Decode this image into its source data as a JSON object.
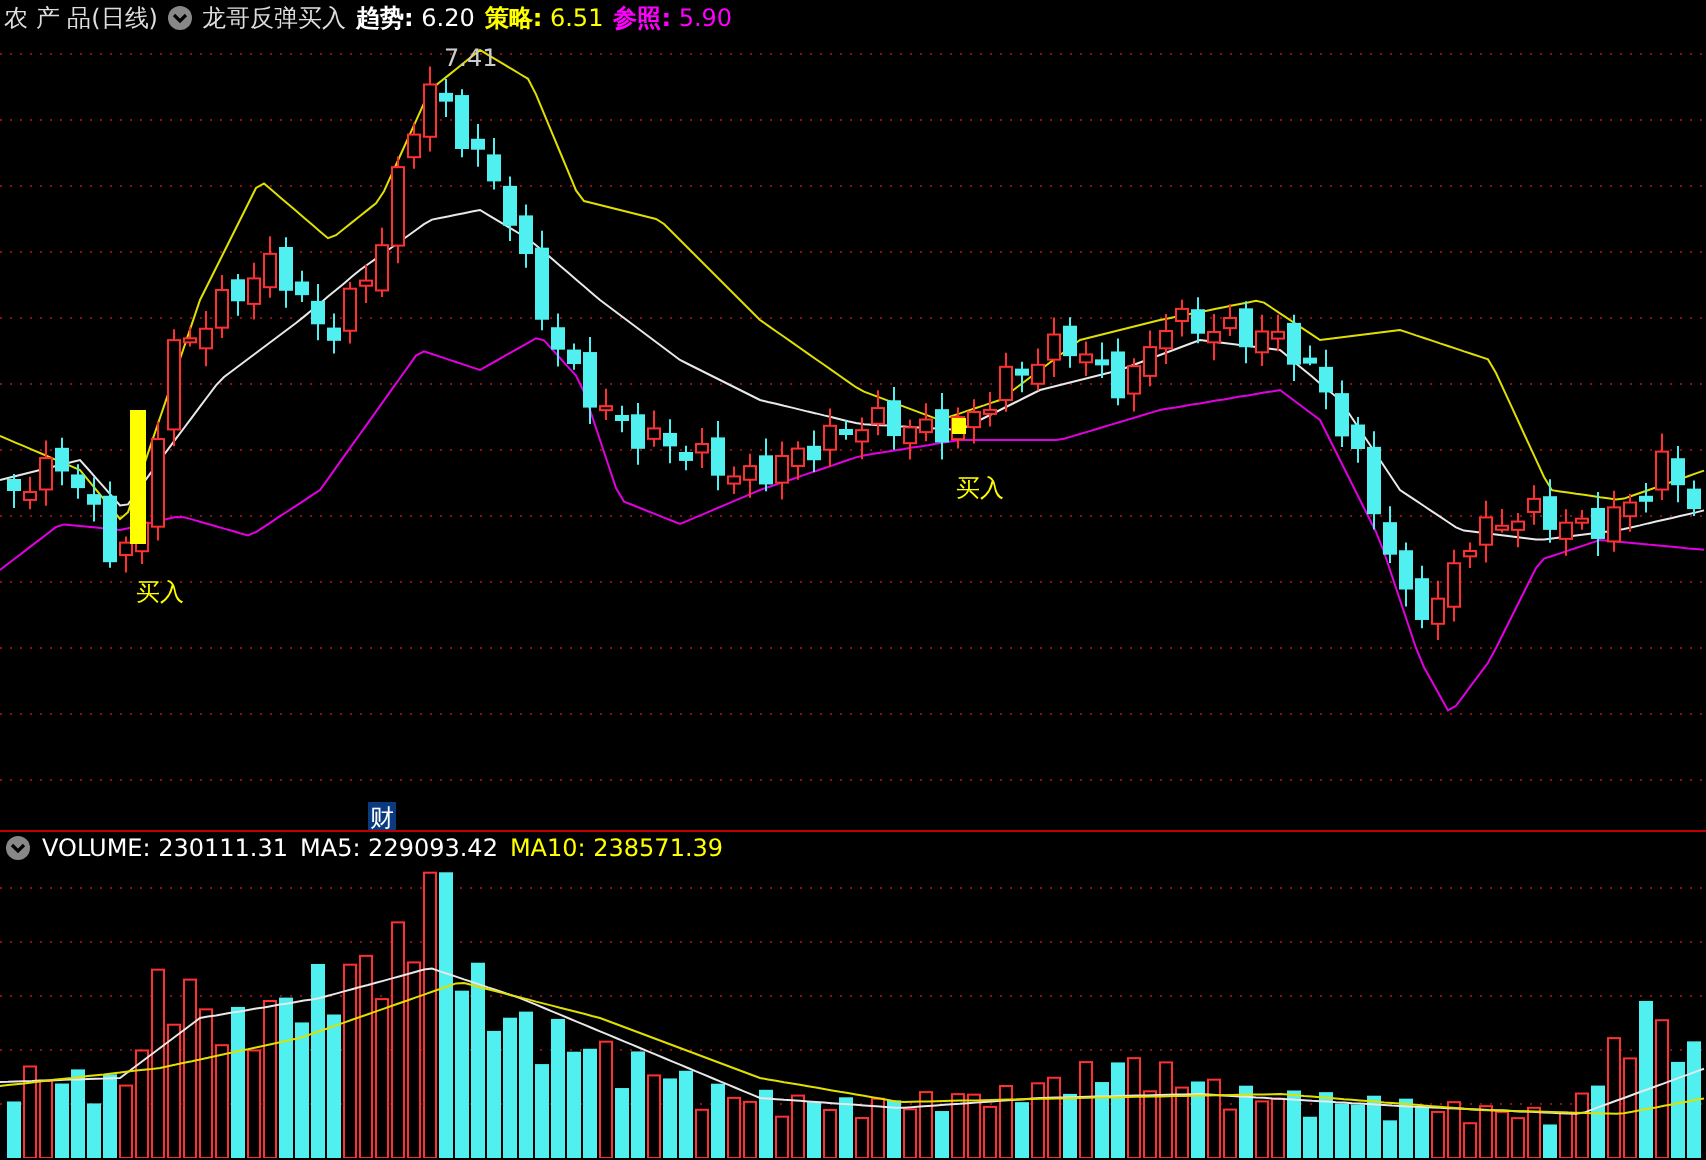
{
  "header": {
    "title": "农 产 品(日线)",
    "indicator": "龙哥反弹买入",
    "readings": [
      {
        "label": "趋势:",
        "value": "6.20",
        "color": "#ffffff"
      },
      {
        "label": "策略:",
        "value": "6.51",
        "color": "#ffff00"
      },
      {
        "label": "参照:",
        "value": "5.90",
        "color": "#ff00ff"
      }
    ]
  },
  "price_chart": {
    "high_label": "7.41",
    "signals": [
      "买入",
      "买入"
    ],
    "finance_badge": "财"
  },
  "volume_header": {
    "readings": [
      {
        "label": "VOLUME:",
        "value": "230111.31",
        "color": "#ffffff"
      },
      {
        "label": "MA5:",
        "value": "229093.42",
        "color": "#ffffff"
      },
      {
        "label": "MA10:",
        "value": "238571.39",
        "color": "#ffff00"
      }
    ]
  }
}
